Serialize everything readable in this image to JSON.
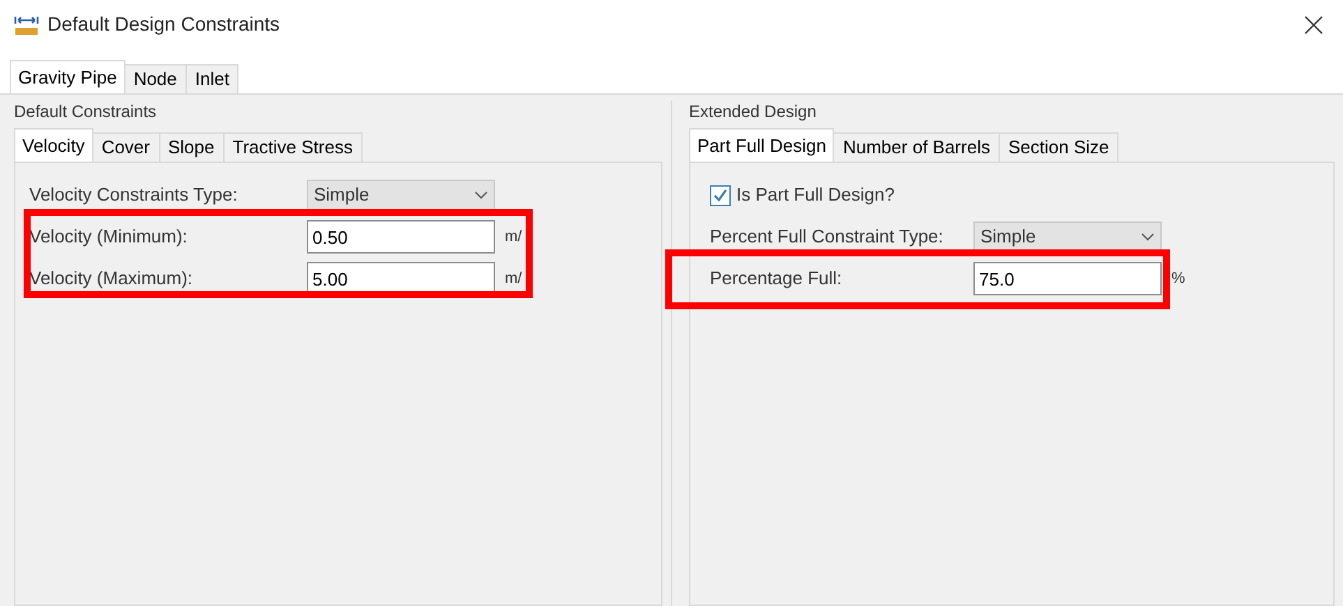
{
  "window": {
    "title": "Default Design Constraints"
  },
  "tabs": [
    {
      "label": "Gravity Pipe",
      "selected": true
    },
    {
      "label": "Node",
      "selected": false
    },
    {
      "label": "Inlet",
      "selected": false
    }
  ],
  "default_constraints": {
    "title": "Default Constraints",
    "tabs": [
      {
        "label": "Velocity",
        "selected": true
      },
      {
        "label": "Cover",
        "selected": false
      },
      {
        "label": "Slope",
        "selected": false
      },
      {
        "label": "Tractive Stress",
        "selected": false
      }
    ],
    "rows": [
      {
        "kind": "dropdown",
        "label": "Velocity Constraints Type:",
        "value": "Simple"
      },
      {
        "kind": "input",
        "label": "Velocity (Minimum):",
        "value": "0.50",
        "unit": "m/"
      },
      {
        "kind": "input",
        "label": "Velocity (Maximum):",
        "value": "5.00",
        "unit": "m/"
      }
    ]
  },
  "extended_design": {
    "title": "Extended Design",
    "tabs": [
      {
        "label": "Part Full Design",
        "selected": true
      },
      {
        "label": "Number of Barrels",
        "selected": false
      },
      {
        "label": "Section Size",
        "selected": false
      }
    ],
    "rows": [
      {
        "kind": "checkbox",
        "label": "Is Part Full Design?",
        "checked": true
      },
      {
        "kind": "dropdown",
        "label": "Percent Full Constraint Type:",
        "value": "Simple"
      },
      {
        "kind": "input",
        "label": "Percentage Full:",
        "value": "75.0",
        "unit": "%"
      }
    ]
  }
}
